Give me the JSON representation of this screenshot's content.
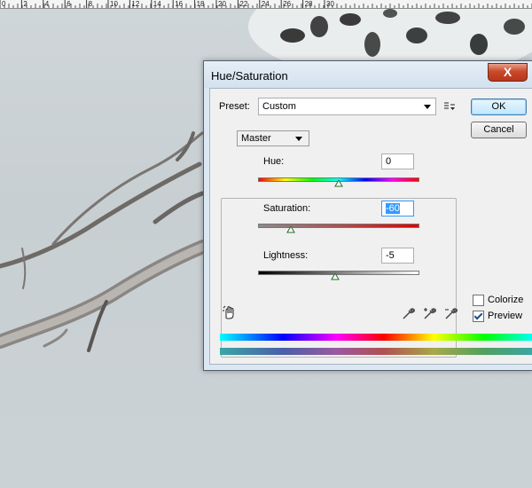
{
  "ruler": {
    "labels": [
      "0",
      "2",
      "4",
      "6",
      "8",
      "10",
      "12",
      "14",
      "16",
      "18",
      "20",
      "22",
      "24",
      "26",
      "28",
      "30"
    ]
  },
  "dialog": {
    "title": "Hue/Saturation",
    "close_label": "X",
    "preset_label": "Preset:",
    "preset_value": "Custom",
    "ok_label": "OK",
    "cancel_label": "Cancel",
    "channel_value": "Master",
    "hue": {
      "label": "Hue:",
      "value": "0"
    },
    "saturation": {
      "label": "Saturation:",
      "value": "-60"
    },
    "lightness": {
      "label": "Lightness:",
      "value": "-5"
    },
    "colorize": {
      "label": "Colorize",
      "checked": false
    },
    "preview": {
      "label": "Preview",
      "checked": true
    }
  },
  "icons": {
    "preset_options": "preset-options-icon",
    "targeted_adjustment": "hand-tool-icon",
    "eyedroppers": [
      "eyedropper-icon",
      "eyedropper-plus-icon",
      "eyedropper-minus-icon"
    ]
  },
  "colors": {
    "dialog_frame": "#dbe7f2",
    "close_button": "#c94a2a",
    "selection": "#3399ff"
  }
}
